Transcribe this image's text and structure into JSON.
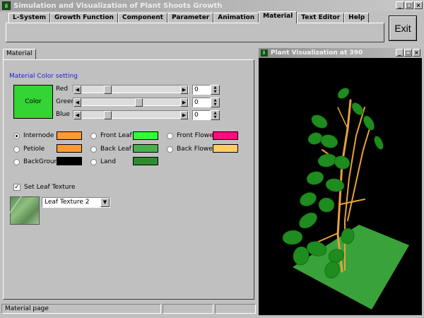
{
  "window": {
    "title": "Simulation and Visualization of Plant Shoots Growth",
    "min_glyph": "_",
    "max_glyph": "□",
    "close_glyph": "×"
  },
  "tabs": [
    "L-System",
    "Growth Function",
    "Component",
    "Parameter",
    "Animation",
    "Material",
    "Text Editor",
    "Help"
  ],
  "active_tab": "Material",
  "exit_label": "Exit",
  "material_tab": "Material",
  "color_setting": {
    "title": "Material Color setting",
    "button_label": "Color",
    "button_color": "#35d435",
    "sliders": [
      {
        "label": "Red",
        "value": "0",
        "level": 0.25
      },
      {
        "label": "Green",
        "value": "0",
        "level": 0.59
      },
      {
        "label": "Blue",
        "value": "0",
        "level": 0.25
      }
    ]
  },
  "parts": [
    {
      "label": "Internode",
      "color": "#ff9933",
      "selected": true
    },
    {
      "label": "Petiole",
      "color": "#ff9933",
      "selected": false
    },
    {
      "label": "BackGround",
      "color": "#000000",
      "selected": false
    },
    {
      "label": "Front Leaf",
      "color": "#33ff33",
      "selected": false
    },
    {
      "label": "Back Leaf",
      "color": "#4caf50",
      "selected": false
    },
    {
      "label": "Land",
      "color": "#2e8b2e",
      "selected": false
    },
    {
      "label": "Front Flower",
      "color": "#ff0a7f",
      "selected": false
    },
    {
      "label": "Back Flower",
      "color": "#ffcc66",
      "selected": false
    }
  ],
  "texture": {
    "checkbox_label": "Set Leaf Texture",
    "checked": true,
    "selected": "Leaf Texture 2"
  },
  "status_text": "Material page",
  "viz_title": "Plant Visualization at 390",
  "colors": {
    "ground": "#3aa23a",
    "leaf": "#1e8c1e",
    "stem": "#e8a23c"
  }
}
